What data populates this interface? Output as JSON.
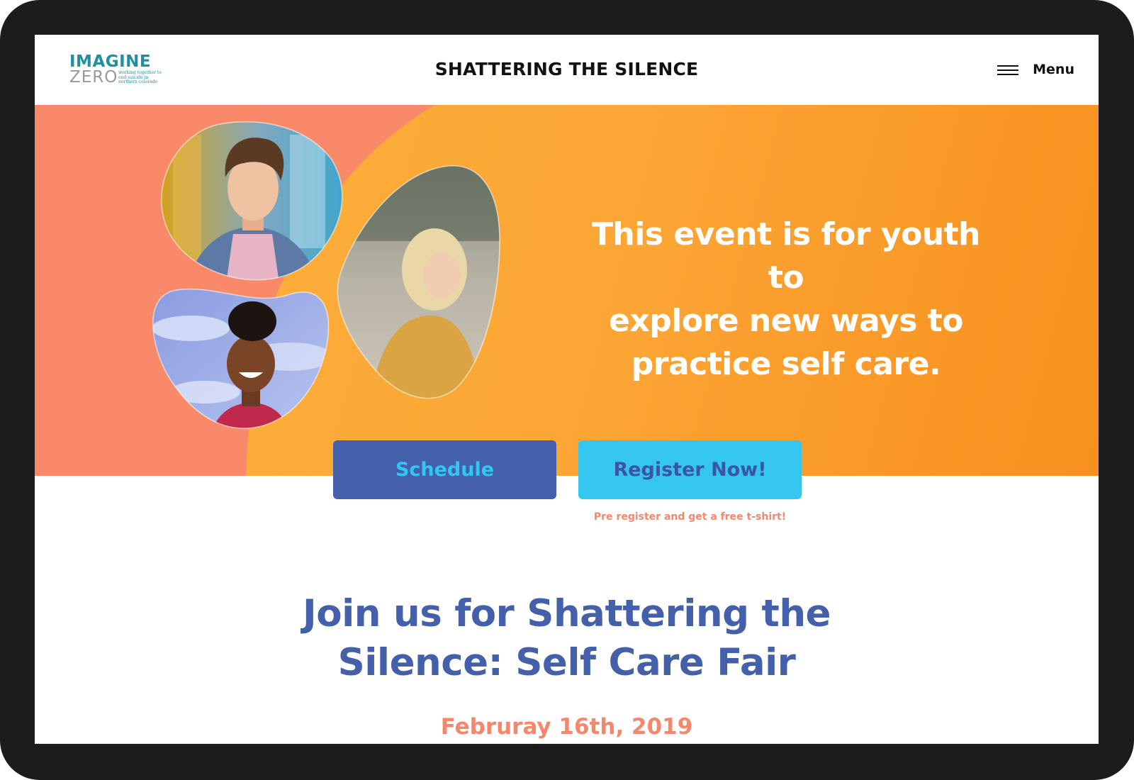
{
  "logo": {
    "word1": "IMAGINE",
    "word2": "ZERO",
    "tagline": "working together to end suicide in northern colorado"
  },
  "header": {
    "title": "SHATTERING THE SILENCE",
    "menu_label": "Menu"
  },
  "hero": {
    "headline_line1": "This event is for youth to",
    "headline_line2": "explore new ways to",
    "headline_line3": "practice self care."
  },
  "actions": {
    "schedule_label": "Schedule",
    "register_label": "Register Now!",
    "promo_text": "Pre register and get a free t-shirt!"
  },
  "event": {
    "heading_line1": "Join us for Shattering the",
    "heading_line2": "Silence: Self Care Fair",
    "date": "Februray 16th, 2019"
  },
  "colors": {
    "coral": "#f98a69",
    "orange": "#fca535",
    "navy_blue": "#4460ab",
    "sky_blue": "#35c6f0",
    "teal": "#1f8fa1"
  }
}
